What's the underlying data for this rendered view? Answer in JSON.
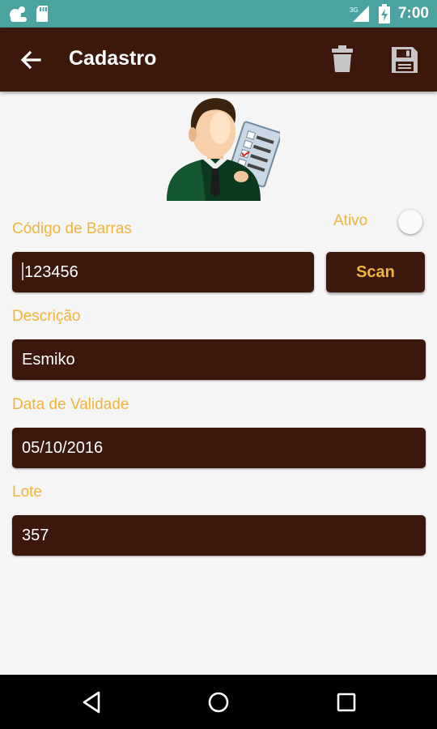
{
  "status_bar": {
    "time": "7:00",
    "network": "3G",
    "icons": [
      "notification-app-icon",
      "sd-card-icon",
      "signal-icon",
      "battery-charging-icon"
    ]
  },
  "app_bar": {
    "title": "Cadastro",
    "icons": [
      "back-arrow-icon",
      "trash-icon",
      "save-icon"
    ]
  },
  "form": {
    "barcode_label": "Código de Barras",
    "active_label": "Ativo",
    "active": false,
    "barcode_value": "123456",
    "scan_label": "Scan",
    "description_label": "Descrição",
    "description_value": "Esmiko",
    "expiry_label": "Data de Validade",
    "expiry_value": "05/10/2016",
    "batch_label": "Lote",
    "batch_value": "357"
  },
  "nav_bar": {
    "icons": [
      "nav-back-icon",
      "nav-home-icon",
      "nav-recents-icon"
    ]
  },
  "colors": {
    "primary_dark": "#3b170c",
    "accent": "#f0b43a",
    "status_bar": "#4aa39f"
  }
}
